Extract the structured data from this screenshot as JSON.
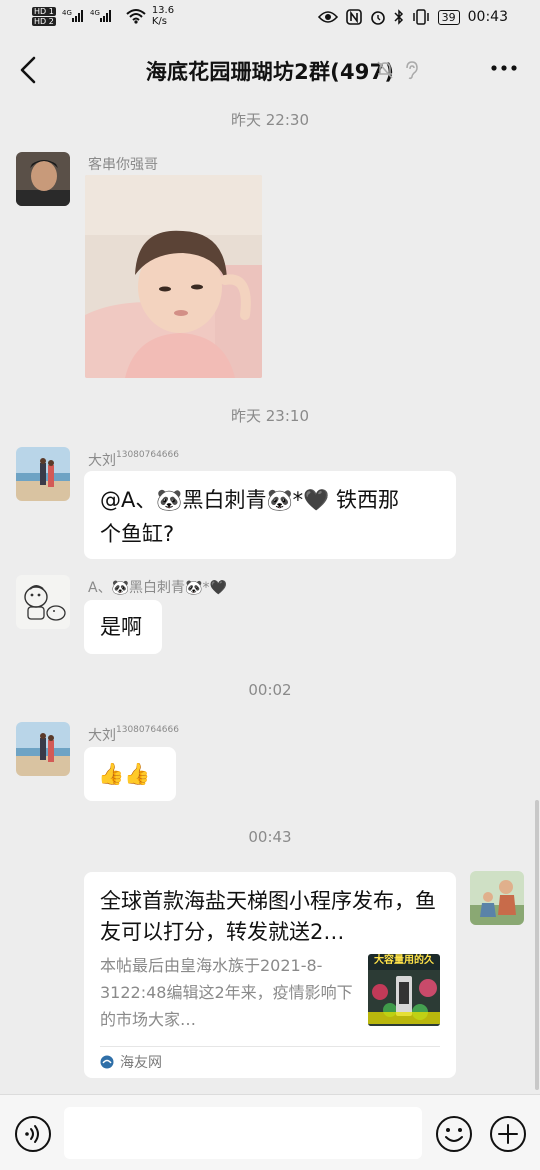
{
  "status_bar": {
    "hd1": "HD 1",
    "hd2": "HD 2",
    "net_speed_value": "13.6",
    "net_speed_unit": "K/s",
    "battery": "39",
    "clock": "00:43"
  },
  "header": {
    "title": "海底花园珊瑚坊2群(497)"
  },
  "messages": [
    {
      "type": "time",
      "text": "昨天 22:30"
    },
    {
      "type": "image",
      "sender": "客串你强哥"
    },
    {
      "type": "time",
      "text": "昨天 23:10"
    },
    {
      "type": "text",
      "sender": "大刘",
      "sender_suffix": "13080764666",
      "line1": "@A、🐼黑白刺青🐼*🖤  铁西那",
      "line2": "个鱼缸?"
    },
    {
      "type": "text",
      "sender": "A、🐼黑白刺青🐼*🖤",
      "line1": "是啊"
    },
    {
      "type": "time",
      "text": "00:02"
    },
    {
      "type": "text",
      "sender": "大刘",
      "sender_suffix": "13080764666",
      "line1": "👍👍"
    },
    {
      "type": "time",
      "text": "00:43"
    },
    {
      "type": "link_card",
      "title": "全球首款海盐天梯图小程序发布，鱼友可以打分，转发就送2…",
      "description": "本帖最后由皇海水族于2021-8-3122:48编辑这2年来，疫情影响下的市场大家…",
      "thumb_text": "大容量用的久",
      "source": "海友网"
    }
  ],
  "input": {
    "placeholder": ""
  },
  "icons": {
    "back": "chevron-left-icon",
    "mute": "bell-off-icon",
    "more": "more-dots-icon",
    "voice": "voice-icon",
    "emoji": "emoji-icon",
    "plus": "plus-icon"
  },
  "colors": {
    "background": "#ededed",
    "bubble": "#ffffff",
    "meta_text": "#8a8a8a"
  }
}
